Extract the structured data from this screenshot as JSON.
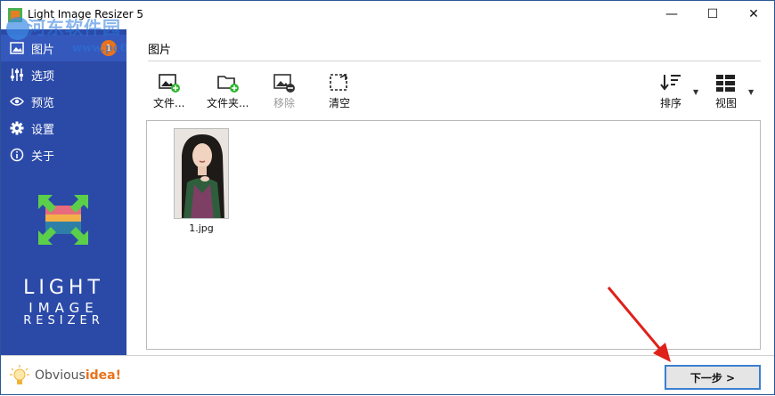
{
  "window": {
    "title": "Light Image Resizer 5",
    "minimize_glyph": "—",
    "maximize_glyph": "☐",
    "close_glyph": "✕"
  },
  "watermark": {
    "line1": "河东软件园",
    "line2": "www.pc0359.cn"
  },
  "sidebar": {
    "items": [
      {
        "label": "图片",
        "icon": "image-icon",
        "badge": "1"
      },
      {
        "label": "选项",
        "icon": "sliders-icon"
      },
      {
        "label": "预览",
        "icon": "eye-icon"
      },
      {
        "label": "设置",
        "icon": "gear-icon"
      },
      {
        "label": "关于",
        "icon": "info-icon"
      }
    ],
    "brand": [
      "LIGHT",
      "IMAGE",
      "RESIZER"
    ],
    "vendor_prefix": "Obvious",
    "vendor_suffix": "idea!"
  },
  "content": {
    "section_title": "图片",
    "toolbar": {
      "add_files": "文件...",
      "add_folder": "文件夹...",
      "remove": "移除",
      "clear": "清空",
      "sort": "排序",
      "view": "视图"
    },
    "files": [
      {
        "name": "1.jpg"
      }
    ]
  },
  "footer": {
    "next_label": "下一步 >"
  },
  "colors": {
    "sidebar_bg": "#2b4aa8",
    "badge": "#e8731c",
    "add_green": "#2fb52f",
    "next_border": "#3c7fd1",
    "annotation_arrow": "#e0201a"
  }
}
